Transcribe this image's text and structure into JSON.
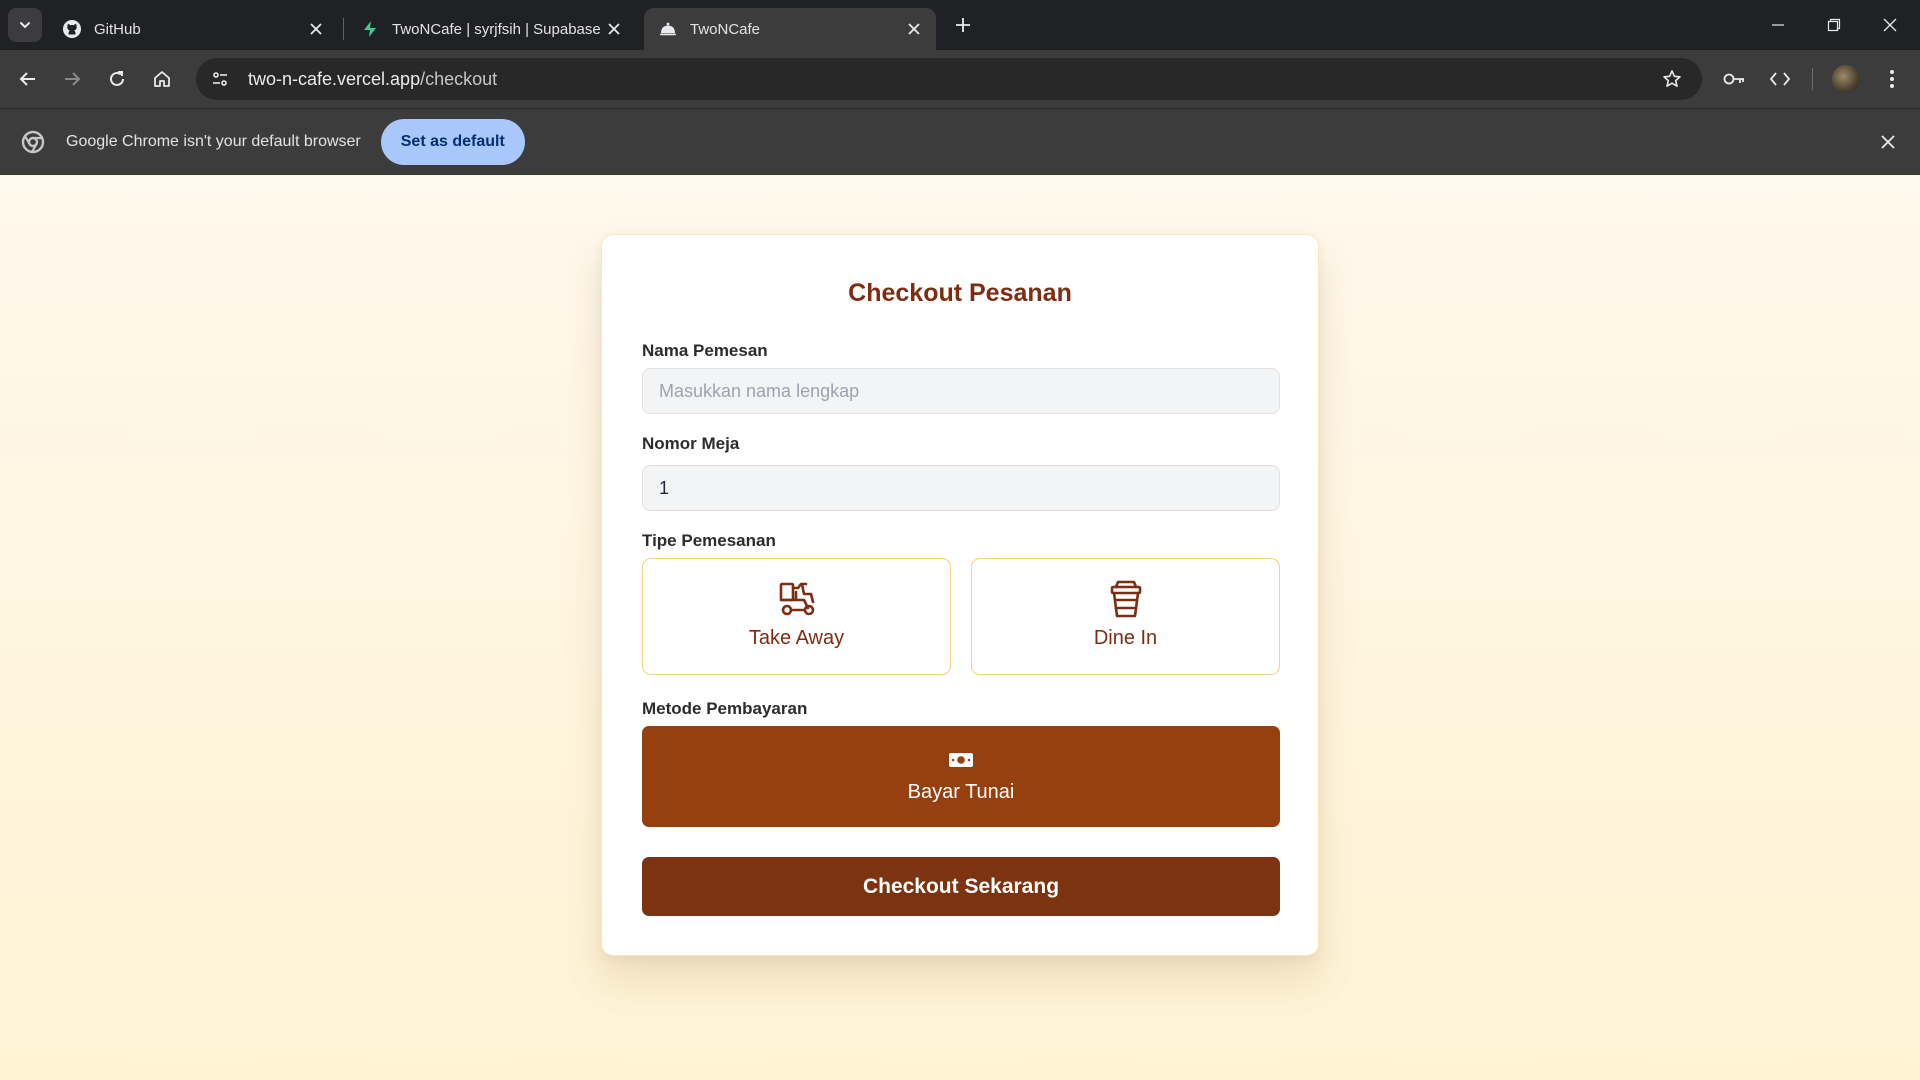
{
  "browser": {
    "tabs": [
      {
        "title": "GitHub",
        "icon": "github-icon",
        "active": false
      },
      {
        "title": "TwoNCafe | syrjfsih | Supabase",
        "icon": "supabase-icon",
        "active": false
      },
      {
        "title": "TwoNCafe",
        "icon": "cafe-cloche-icon",
        "active": true
      }
    ],
    "url_host": "two-n-cafe.vercel.app",
    "url_path": "/checkout",
    "infobar": {
      "message": "Google Chrome isn't your default browser",
      "button": "Set as default"
    }
  },
  "checkout": {
    "title": "Checkout Pesanan",
    "name_label": "Nama Pemesan",
    "name_placeholder": "Masukkan nama lengkap",
    "name_value": "",
    "table_label": "Nomor Meja",
    "table_value": "1",
    "order_type_label": "Tipe Pemesanan",
    "order_types": [
      {
        "label": "Take Away",
        "icon": "delivery-scooter-icon"
      },
      {
        "label": "Dine In",
        "icon": "coffee-cup-icon"
      }
    ],
    "payment_label": "Metode Pembayaran",
    "payment": {
      "label": "Bayar Tunai",
      "icon": "cash-icon"
    },
    "submit_label": "Checkout Sekarang"
  },
  "colors": {
    "brand_brown": "#7c2d12",
    "payment_bg": "#964010",
    "submit_bg": "#7c3410",
    "option_border": "#f3d27a",
    "page_bg": "#fff7e3"
  }
}
